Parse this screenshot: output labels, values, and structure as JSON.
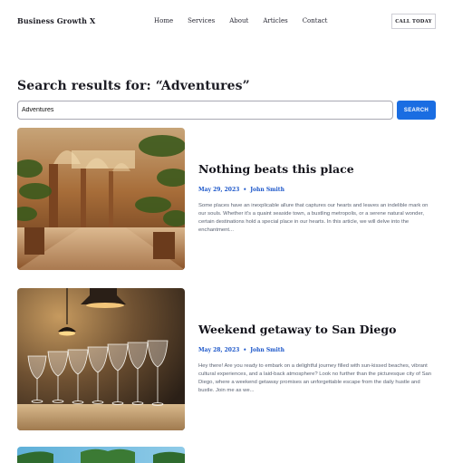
{
  "header": {
    "brand": "Business Growth X",
    "nav": [
      "Home",
      "Services",
      "About",
      "Articles",
      "Contact"
    ],
    "cta_label": "CALL TODAY"
  },
  "search": {
    "title": "Search results for: “Adventures”",
    "value": "Adventures",
    "button_label": "SEARCH"
  },
  "articles": [
    {
      "title": "Nothing beats this place",
      "date": "May 29, 2023",
      "author": "John Smith",
      "excerpt": "Some places have an inexplicable allure that captures our hearts and leaves an indelible mark on our souls. Whether it's a quaint seaside town, a bustling metropolis, or a serene natural wonder, certain destinations hold a special place in our hearts. In this article, we will delve into the enchantment..."
    },
    {
      "title": "Weekend getaway to San Diego",
      "date": "May 28, 2023",
      "author": "John Smith",
      "excerpt": "Hey there! Are you ready to embark on a delightful journey filled with sun-kissed beaches, vibrant cultural experiences, and a laid-back atmosphere? Look no further than the picturesque city of San Diego, where a weekend getaway promises an unforgettable escape from the daily hustle and bustle. Join me as we..."
    }
  ],
  "colors": {
    "accent": "#1a6de2",
    "meta": "#1a55c9",
    "excerpt": "#5b6373"
  }
}
